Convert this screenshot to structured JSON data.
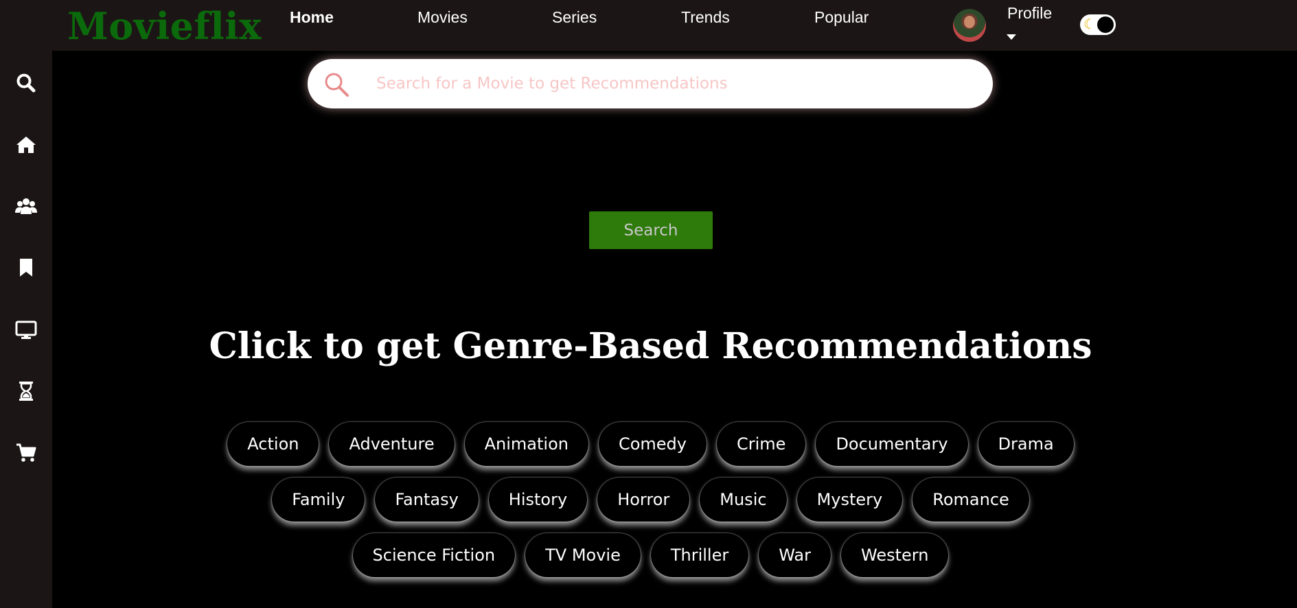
{
  "header": {
    "logo": "Movieflix",
    "nav": [
      {
        "label": "Home",
        "active": true
      },
      {
        "label": "Movies",
        "active": false
      },
      {
        "label": "Series",
        "active": false
      },
      {
        "label": "Trends",
        "active": false
      },
      {
        "label": "Popular",
        "active": false
      }
    ],
    "profile_label": "Profile",
    "theme_toggle": {
      "icon": "moon-icon",
      "mode": "dark"
    }
  },
  "sidebar": {
    "icons": [
      "search-icon",
      "home-icon",
      "users-icon",
      "bookmark-icon",
      "monitor-icon",
      "hourglass-icon",
      "cart-icon"
    ]
  },
  "search": {
    "placeholder": "Search for a Movie to get Recommendations",
    "button_label": "Search"
  },
  "genres": {
    "title": "Click to get Genre-Based Recommendations",
    "rows": [
      [
        "Action",
        "Adventure",
        "Animation",
        "Comedy",
        "Crime",
        "Documentary",
        "Drama"
      ],
      [
        "Family",
        "Fantasy",
        "History",
        "Horror",
        "Music",
        "Mystery",
        "Romance"
      ],
      [
        "Science Fiction",
        "TV Movie",
        "Thriller",
        "War",
        "Western"
      ]
    ]
  },
  "colors": {
    "logo": "#0b6a0b",
    "bars": "#1c1515",
    "search_button": "#2e7a0b",
    "placeholder": "#f7c6c6",
    "search_icon": "#e88a8a"
  }
}
